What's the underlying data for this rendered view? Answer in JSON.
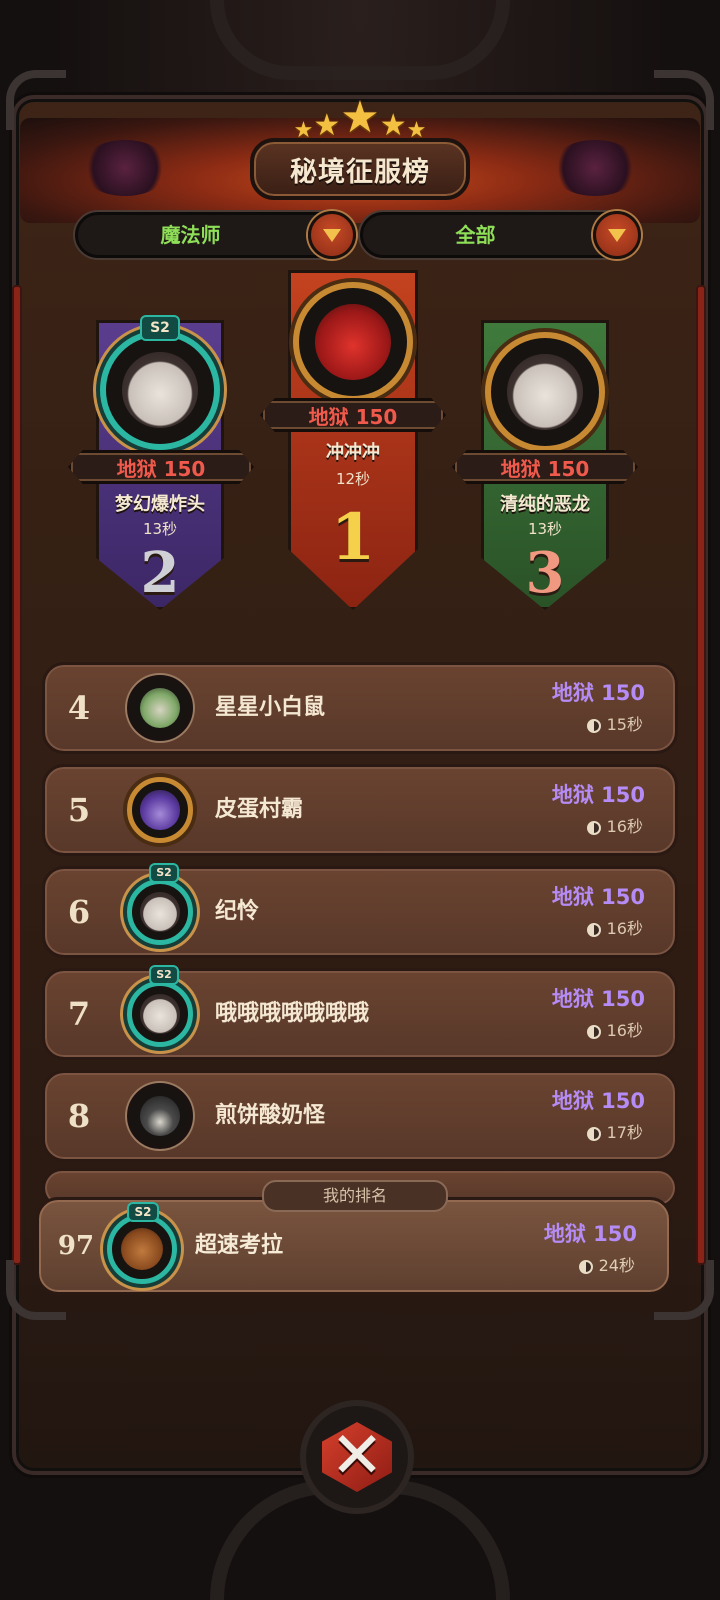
{
  "header": {
    "title": "秘境征服榜",
    "stars": 5
  },
  "filters": {
    "class_value": "魔法师",
    "scope_value": "全部"
  },
  "podium": [
    {
      "rank": "1",
      "score": "地狱 150",
      "name": "冲冲冲",
      "time": "12秒",
      "badge": "",
      "avatar_icon": "red-demon-avatar"
    },
    {
      "rank": "2",
      "score": "地狱 150",
      "name": "梦幻爆炸头",
      "time": "13秒",
      "badge": "S2",
      "avatar_icon": "sheep-avatar"
    },
    {
      "rank": "3",
      "score": "地狱 150",
      "name": "清纯的恶龙",
      "time": "13秒",
      "badge": "",
      "avatar_icon": "sheep-avatar"
    }
  ],
  "list": [
    {
      "rank": "4",
      "name": "星星小白鼠",
      "score": "地狱 150",
      "time": "15秒",
      "badge": "",
      "avatar_icon": "fox-avatar"
    },
    {
      "rank": "5",
      "name": "皮蛋村霸",
      "score": "地狱 150",
      "time": "16秒",
      "badge": "",
      "avatar_icon": "wizard-avatar"
    },
    {
      "rank": "6",
      "name": "纪怜",
      "score": "地狱 150",
      "time": "16秒",
      "badge": "S2",
      "avatar_icon": "sheep-avatar"
    },
    {
      "rank": "7",
      "name": "哦哦哦哦哦哦哦",
      "score": "地狱 150",
      "time": "16秒",
      "badge": "S2",
      "avatar_icon": "sheep-avatar"
    },
    {
      "rank": "8",
      "name": "煎饼酸奶怪",
      "score": "地狱 150",
      "time": "17秒",
      "badge": "",
      "avatar_icon": "hooded-avatar"
    }
  ],
  "my_rank": {
    "label": "我的排名",
    "rank": "97",
    "name": "超速考拉",
    "score": "地狱 150",
    "time": "24秒",
    "badge": "S2",
    "avatar_icon": "koala-avatar"
  },
  "colors": {
    "hell_score_podium": "#f05a4c",
    "hell_score_list": "#b58bf5",
    "filter_text": "#8ede58",
    "rank1_pennant": "#c4421f",
    "rank2_pennant": "#5b3d8e",
    "rank3_pennant": "#3f7a3c"
  }
}
